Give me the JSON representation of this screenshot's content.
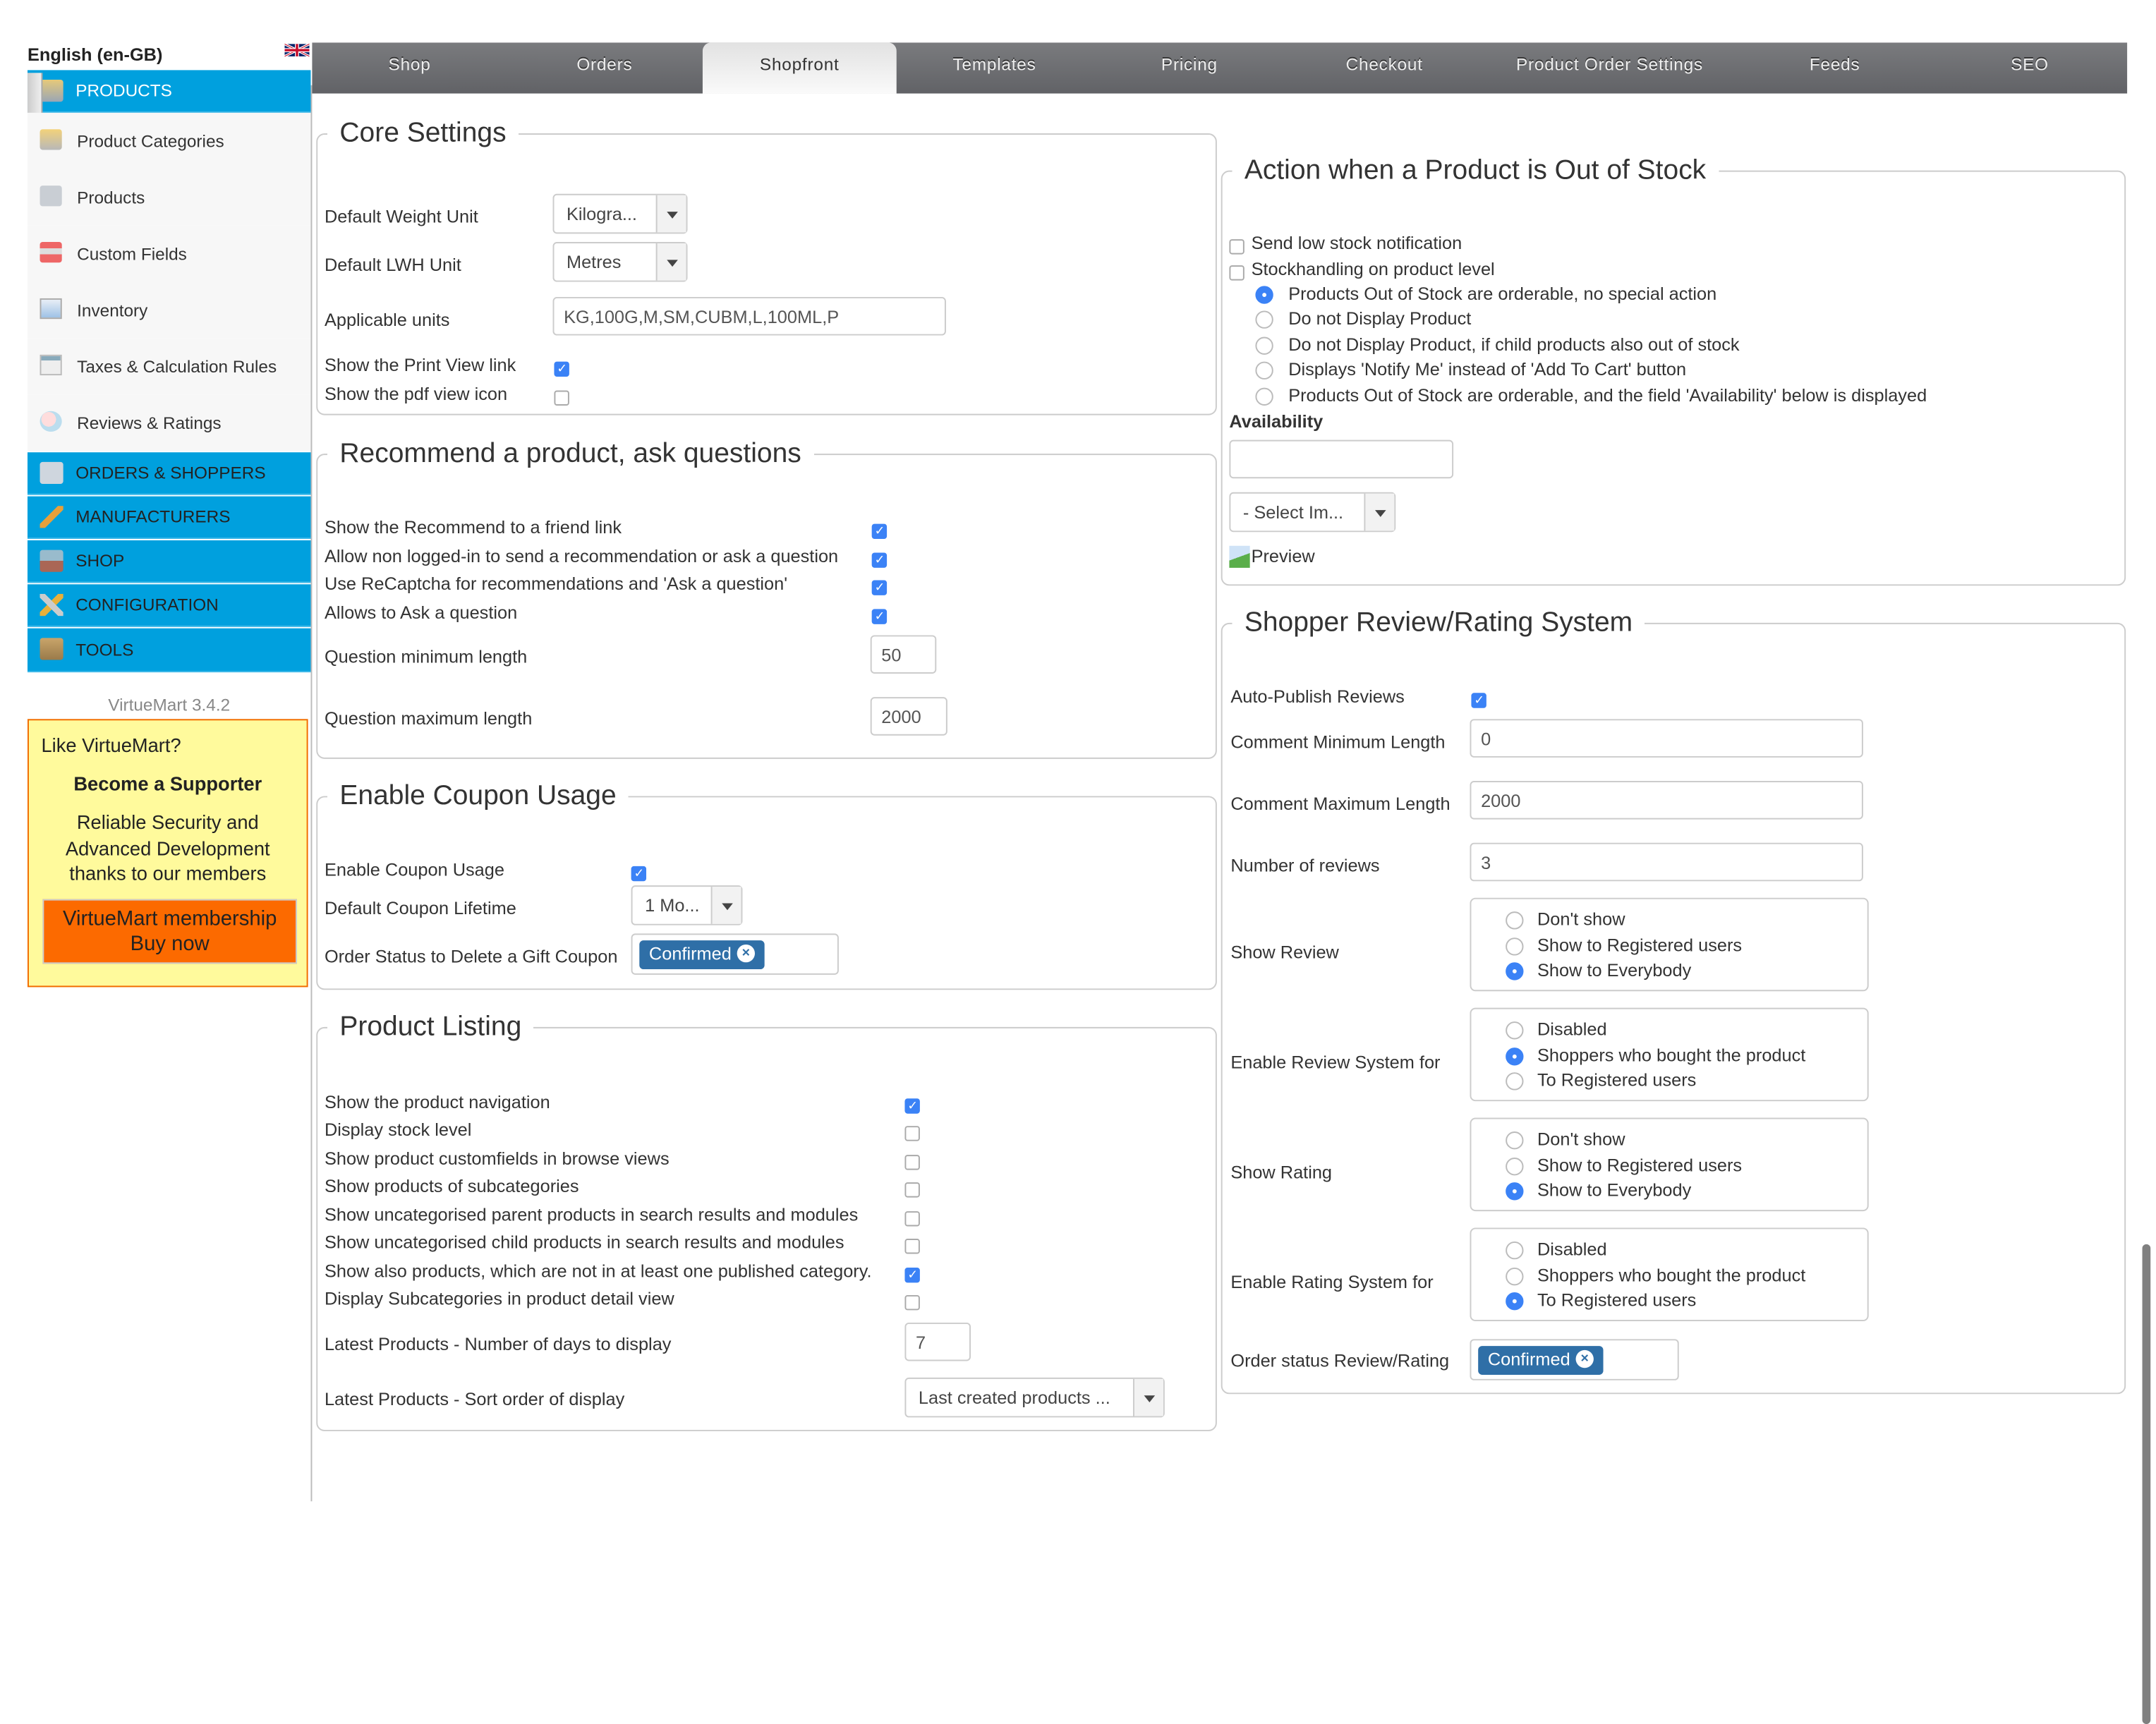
{
  "sidebar": {
    "language": "English (en-GB)",
    "flag_icon": "uk-flag-icon",
    "sections": [
      {
        "label": "PRODUCTS",
        "icon": "products-icon",
        "active": true
      },
      {
        "label": "ORDERS & SHOPPERS",
        "icon": "orders-icon"
      },
      {
        "label": "MANUFACTURERS",
        "icon": "wrench-icon"
      },
      {
        "label": "SHOP",
        "icon": "shop-icon"
      },
      {
        "label": "CONFIGURATION",
        "icon": "configuration-icon"
      },
      {
        "label": "TOOLS",
        "icon": "tools-icon"
      }
    ],
    "product_items": [
      {
        "label": "Product Categories",
        "icon": "folder-icon"
      },
      {
        "label": "Products",
        "icon": "camera-icon"
      },
      {
        "label": "Custom Fields",
        "icon": "custom-fields-icon"
      },
      {
        "label": "Inventory",
        "icon": "chart-icon"
      },
      {
        "label": "Taxes & Calculation Rules",
        "icon": "calculator-icon"
      },
      {
        "label": "Reviews & Ratings",
        "icon": "speech-bubbles-icon"
      }
    ],
    "version": "VirtueMart 3.4.2",
    "promo": {
      "question": "Like VirtueMart?",
      "headline": "Become a Supporter",
      "body": "Reliable Security and Advanced Development thanks to our members",
      "button_line1": "VirtueMart membership",
      "button_line2": "Buy now"
    },
    "colors": {
      "menu_blue": "#00a0de",
      "promo_bg": "#fffa9c",
      "promo_button": "#fc6a00"
    }
  },
  "tabs": [
    {
      "label": "Shop"
    },
    {
      "label": "Orders"
    },
    {
      "label": "Shopfront",
      "active": true
    },
    {
      "label": "Templates"
    },
    {
      "label": "Pricing"
    },
    {
      "label": "Checkout"
    },
    {
      "label": "Product Order Settings"
    },
    {
      "label": "Feeds"
    },
    {
      "label": "SEO"
    }
  ],
  "core_settings": {
    "title": "Core Settings",
    "weight_unit_label": "Default Weight Unit",
    "weight_unit_value": "Kilogra...",
    "lwh_unit_label": "Default LWH Unit",
    "lwh_unit_value": "Metres",
    "applicable_units_label": "Applicable units",
    "applicable_units_value": "KG,100G,M,SM,CUBM,L,100ML,P",
    "print_view_label": "Show the Print View link",
    "print_view_checked": true,
    "pdf_icon_label": "Show the pdf view icon",
    "pdf_icon_checked": false
  },
  "recommend": {
    "title": "Recommend a product, ask questions",
    "checks": [
      {
        "label": "Show the Recommend to a friend link",
        "checked": true
      },
      {
        "label": "Allow non logged-in to send a recommendation or ask a question",
        "checked": true
      },
      {
        "label": "Use ReCaptcha for recommendations and 'Ask a question'",
        "checked": true
      },
      {
        "label": "Allows to Ask a question",
        "checked": true
      }
    ],
    "min_label": "Question minimum length",
    "min_value": "50",
    "max_label": "Question maximum length",
    "max_value": "2000"
  },
  "coupon": {
    "title": "Enable Coupon Usage",
    "enable_label": "Enable Coupon Usage",
    "enable_checked": true,
    "lifetime_label": "Default Coupon Lifetime",
    "lifetime_value": "1 Mo...",
    "delete_status_label": "Order Status to Delete a Gift Coupon",
    "delete_status_chip": "Confirmed"
  },
  "listing": {
    "title": "Product Listing",
    "checks": [
      {
        "label": "Show the product navigation",
        "checked": true
      },
      {
        "label": "Display stock level",
        "checked": false
      },
      {
        "label": "Show product customfields in browse views",
        "checked": false
      },
      {
        "label": "Show products of subcategories",
        "checked": false
      },
      {
        "label": "Show uncategorised parent products in search results and modules",
        "checked": false
      },
      {
        "label": "Show uncategorised child products in search results and modules",
        "checked": false
      },
      {
        "label": "Show also products, which are not in at least one published category.",
        "checked": true
      },
      {
        "label": "Display Subcategories in product detail view",
        "checked": false
      }
    ],
    "days_label": "Latest Products - Number of days to display",
    "days_value": "7",
    "sort_label": "Latest Products - Sort order of display",
    "sort_value": "Last created products ..."
  },
  "out_of_stock": {
    "title": "Action when a Product is Out of Stock",
    "low_stock_label": "Send low stock notification",
    "low_stock_checked": false,
    "product_level_label": "Stockhandling on product level",
    "product_level_checked": false,
    "options": [
      {
        "label": "Products Out of Stock are orderable, no special action",
        "selected": true
      },
      {
        "label": "Do not Display Product",
        "selected": false
      },
      {
        "label": "Do not Display Product, if child products also out of stock",
        "selected": false
      },
      {
        "label": "Displays 'Notify Me' instead of 'Add To Cart' button",
        "selected": false
      },
      {
        "label": "Products Out of Stock are orderable, and the field 'Availability' below is displayed",
        "selected": false
      }
    ],
    "availability_label": "Availability",
    "availability_value": "",
    "image_select_value": "- Select Im...",
    "preview_alt": "Preview"
  },
  "reviews": {
    "title": "Shopper Review/Rating System",
    "auto_publish_label": "Auto-Publish Reviews",
    "auto_publish_checked": true,
    "comment_min_label": "Comment Minimum Length",
    "comment_min_value": "0",
    "comment_max_label": "Comment Maximum Length",
    "comment_max_value": "2000",
    "num_reviews_label": "Number of reviews",
    "num_reviews_value": "3",
    "show_review": {
      "label": "Show Review",
      "options": [
        {
          "label": "Don't show",
          "selected": false
        },
        {
          "label": "Show to Registered users",
          "selected": false
        },
        {
          "label": "Show to Everybody",
          "selected": true
        }
      ]
    },
    "review_system": {
      "label": "Enable Review System for",
      "options": [
        {
          "label": "Disabled",
          "selected": false
        },
        {
          "label": "Shoppers who bought the product",
          "selected": true
        },
        {
          "label": "To Registered users",
          "selected": false
        }
      ]
    },
    "show_rating": {
      "label": "Show Rating",
      "options": [
        {
          "label": "Don't show",
          "selected": false
        },
        {
          "label": "Show to Registered users",
          "selected": false
        },
        {
          "label": "Show to Everybody",
          "selected": true
        }
      ]
    },
    "rating_system": {
      "label": "Enable Rating System for",
      "options": [
        {
          "label": "Disabled",
          "selected": false
        },
        {
          "label": "Shoppers who bought the product",
          "selected": false
        },
        {
          "label": "To Registered users",
          "selected": true
        }
      ]
    },
    "order_status_label": "Order status Review/Rating",
    "order_status_chip": "Confirmed"
  }
}
